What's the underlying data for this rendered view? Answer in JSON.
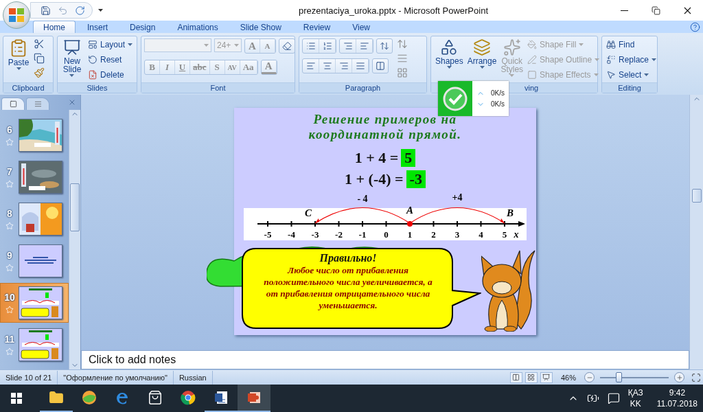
{
  "window": {
    "title": "prezentaciya_uroka.pptx - Microsoft PowerPoint"
  },
  "tabs": [
    {
      "label": "Home",
      "selected": true
    },
    {
      "label": "Insert",
      "selected": false
    },
    {
      "label": "Design",
      "selected": false
    },
    {
      "label": "Animations",
      "selected": false
    },
    {
      "label": "Slide Show",
      "selected": false
    },
    {
      "label": "Review",
      "selected": false
    },
    {
      "label": "View",
      "selected": false
    }
  ],
  "ribbon": {
    "clipboard": {
      "label": "Clipboard",
      "paste": "Paste"
    },
    "slides": {
      "label": "Slides",
      "new_slide": "New Slide",
      "commands": [
        {
          "kind": "layout",
          "label": "Layout"
        },
        {
          "kind": "reset",
          "label": "Reset"
        },
        {
          "kind": "delete",
          "label": "Delete"
        }
      ]
    },
    "font": {
      "label": "Font",
      "font_name_field": {
        "disabled": true
      },
      "font_size": {
        "value": "24+",
        "disabled": true
      },
      "size_buttons": [
        {
          "kind": "grow",
          "label": "A",
          "disabled": true
        },
        {
          "kind": "shrink",
          "label": "A",
          "disabled": true
        }
      ],
      "format_buttons": [
        {
          "kind": "bold",
          "label": "B",
          "disabled": true
        },
        {
          "kind": "italic",
          "label": "I",
          "disabled": true
        },
        {
          "kind": "underline",
          "label": "U",
          "disabled": true
        },
        {
          "kind": "strike",
          "label": "abc",
          "disabled": true
        },
        {
          "kind": "shadow",
          "label": "S",
          "disabled": true
        },
        {
          "kind": "spacing",
          "label": "AV",
          "disabled": true
        },
        {
          "kind": "case",
          "label": "Aa",
          "disabled": true
        }
      ],
      "color_button": {
        "label": "A",
        "disabled": true
      }
    },
    "paragraph": {
      "label": "Paragraph"
    },
    "drawing": {
      "label": "ving",
      "large": [
        {
          "kind": "shapes",
          "label": "Shapes",
          "disabled": false
        },
        {
          "kind": "arrange",
          "label": "Arrange",
          "disabled": false
        },
        {
          "kind": "styles",
          "label": "Quick Styles",
          "disabled": true
        }
      ],
      "small": [
        {
          "kind": "fill",
          "label": "Shape Fill",
          "disabled": true
        },
        {
          "kind": "outline",
          "label": "Shape Outline",
          "disabled": true
        },
        {
          "kind": "effects",
          "label": "Shape Effects",
          "disabled": true
        }
      ]
    },
    "editing": {
      "label": "Editing",
      "commands": [
        {
          "kind": "find",
          "label": "Find"
        },
        {
          "kind": "replace",
          "label": "Replace"
        },
        {
          "kind": "select",
          "label": "Select"
        }
      ]
    }
  },
  "network_widget": {
    "upload": "0K/s",
    "download": "0K/s"
  },
  "slide_panel": {
    "thumbnails": [
      {
        "number": "6",
        "kind": "beach",
        "selected": false
      },
      {
        "number": "7",
        "kind": "water",
        "selected": false
      },
      {
        "number": "8",
        "kind": "sun",
        "selected": false
      },
      {
        "number": "9",
        "kind": "title",
        "selected": false
      },
      {
        "number": "10",
        "kind": "numberline",
        "selected": true
      },
      {
        "number": "11",
        "kind": "numberline",
        "selected": false
      }
    ]
  },
  "slide": {
    "title": "Решение примеров на координатной прямой.",
    "equations": [
      {
        "expression": "1 + 4 =",
        "answer": "5"
      },
      {
        "expression": "1 + (-4) =",
        "answer": "-3"
      }
    ],
    "number_line": {
      "ticks": [
        "-5",
        "-4",
        "-3",
        "-2",
        "-1",
        "0",
        "1",
        "2",
        "3",
        "4",
        "5"
      ],
      "axis_label": "x",
      "points": [
        {
          "label": "C"
        },
        {
          "label": "A"
        },
        {
          "label": "B"
        }
      ],
      "jumps": [
        {
          "label": "- 4"
        },
        {
          "label": "+4"
        }
      ]
    },
    "bubble": {
      "heading": "Правильно!",
      "text": "Любое число от прибавления положительного числа увеличивается, а от прибавления отрицательного числа уменьшается."
    }
  },
  "notes": {
    "placeholder": "Click to add notes"
  },
  "status_bar": {
    "slide": "Slide 10 of 21",
    "theme": "\"Оформление по умолчанию\"",
    "language": "Russian",
    "zoom": {
      "reading": "46%",
      "level": 0.27
    }
  },
  "taskbar": {
    "apps": [
      {
        "kind": "explorer",
        "running": true,
        "selected": false
      },
      {
        "kind": "app",
        "running": false,
        "selected": false
      },
      {
        "kind": "edge",
        "running": false,
        "selected": false
      },
      {
        "kind": "store",
        "running": false,
        "selected": false
      },
      {
        "kind": "chrome",
        "running": false,
        "selected": false
      },
      {
        "kind": "word",
        "running": true,
        "selected": false
      },
      {
        "kind": "powerpoint",
        "running": true,
        "selected": true
      }
    ],
    "language": "ҚАЗ",
    "layout": "KK",
    "time": "9:42",
    "date": "11.07.2018"
  }
}
